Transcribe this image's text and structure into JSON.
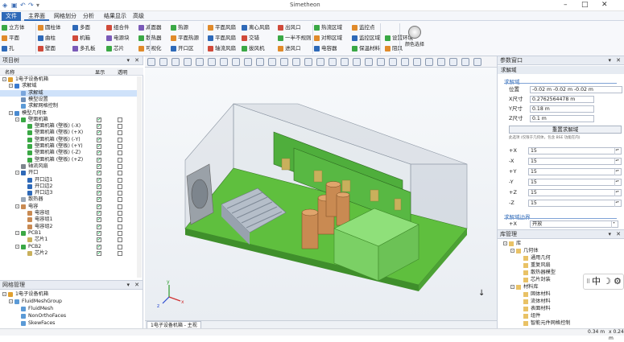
{
  "app": {
    "title": "Simetheon"
  },
  "menu": [
    "文件",
    "主界面",
    "网格划分",
    "分析",
    "结果显示",
    "高级"
  ],
  "ribbon": {
    "row1": [
      "立方体",
      "圆柱体",
      "多面",
      "组合件",
      "减面器",
      "热源",
      "平面风扇",
      "离心风扇",
      "出风口",
      "热流区域",
      "监控点"
    ],
    "row2": [
      "平面",
      "曲柱",
      "机箱",
      "电源块",
      "散热器",
      "平面热源",
      "平面风扇",
      "交错",
      "一半不规则",
      "对称区域",
      "监控区域",
      "设置环境"
    ],
    "row3": [
      "孔",
      "壁面",
      "多孔板",
      "芯片",
      "可视化",
      "开口区",
      "轴流风扇",
      "拔风机",
      "进风口",
      "电容器",
      "保温材料",
      "阻风"
    ],
    "big_button": "颜色选择",
    "colors": {
      "accent": "#2e69b8",
      "green": "#3aa845",
      "orange": "#e08a2a",
      "red": "#d04a3a"
    }
  },
  "left_panel": {
    "title": "项目树",
    "columns": [
      "名称",
      "显示",
      "透明"
    ],
    "tree": [
      {
        "d": 0,
        "label": "1电子设备机箱",
        "icon": "project",
        "exp": "-"
      },
      {
        "d": 1,
        "label": "求解域",
        "icon": "domain",
        "exp": "-"
      },
      {
        "d": 2,
        "label": "求解域",
        "icon": "box",
        "sel": true
      },
      {
        "d": 2,
        "label": "模型设置",
        "icon": "gear"
      },
      {
        "d": 2,
        "label": "求解网格控制",
        "icon": "mesh"
      },
      {
        "d": 1,
        "label": "模型几何体",
        "icon": "geom",
        "exp": "-"
      },
      {
        "d": 2,
        "label": "壁面机箱",
        "icon": "green",
        "exp": "-",
        "cb": [
          true,
          false
        ]
      },
      {
        "d": 3,
        "label": "壁面机箱 (壁板) (-X)",
        "icon": "green",
        "cb": [
          true,
          false
        ]
      },
      {
        "d": 3,
        "label": "壁面机箱 (壁板) (+X)",
        "icon": "green",
        "cb": [
          true,
          false
        ]
      },
      {
        "d": 3,
        "label": "壁面机箱 (壁板) (-Y)",
        "icon": "green",
        "cb": [
          true,
          false
        ]
      },
      {
        "d": 3,
        "label": "壁面机箱 (壁板) (+Y)",
        "icon": "green",
        "cb": [
          true,
          false
        ]
      },
      {
        "d": 3,
        "label": "壁面机箱 (壁板) (-Z)",
        "icon": "green",
        "cb": [
          true,
          false
        ]
      },
      {
        "d": 3,
        "label": "壁面机箱 (壁板) (+Z)",
        "icon": "green",
        "cb": [
          true,
          false
        ]
      },
      {
        "d": 2,
        "label": "轴流风扇",
        "icon": "fan",
        "cb": [
          true,
          false
        ]
      },
      {
        "d": 2,
        "label": "开口",
        "icon": "open",
        "exp": "-",
        "cb": [
          true,
          false
        ]
      },
      {
        "d": 3,
        "label": "开口边1",
        "icon": "open",
        "cb": [
          true,
          false
        ]
      },
      {
        "d": 3,
        "label": "开口边2",
        "icon": "open",
        "cb": [
          true,
          false
        ]
      },
      {
        "d": 3,
        "label": "开口边3",
        "icon": "open",
        "cb": [
          true,
          false
        ]
      },
      {
        "d": 2,
        "label": "散热器",
        "icon": "sink",
        "cb": [
          true,
          false
        ]
      },
      {
        "d": 2,
        "label": "电容",
        "icon": "cap",
        "exp": "-",
        "cb": [
          true,
          false
        ]
      },
      {
        "d": 3,
        "label": "电容组",
        "icon": "cap",
        "cb": [
          true,
          false
        ]
      },
      {
        "d": 3,
        "label": "电容组1",
        "icon": "cap",
        "cb": [
          true,
          false
        ]
      },
      {
        "d": 3,
        "label": "电容组2",
        "icon": "cap",
        "cb": [
          true,
          false
        ]
      },
      {
        "d": 2,
        "label": "PCB1",
        "icon": "pcb",
        "exp": "-",
        "cb": [
          true,
          false
        ]
      },
      {
        "d": 3,
        "label": "芯片1",
        "icon": "chip",
        "cb": [
          true,
          false
        ]
      },
      {
        "d": 2,
        "label": "PCB2",
        "icon": "pcb",
        "exp": "-",
        "cb": [
          true,
          false
        ]
      },
      {
        "d": 3,
        "label": "芯片2",
        "icon": "chip",
        "cb": [
          true,
          false
        ]
      }
    ]
  },
  "mesh_panel": {
    "title": "网格管理",
    "items": [
      {
        "d": 0,
        "label": "1电子设备机箱",
        "exp": "-",
        "icon": "project"
      },
      {
        "d": 1,
        "label": "FluidMeshGroup",
        "exp": "-",
        "icon": "mesh"
      },
      {
        "d": 2,
        "label": "FluidMesh",
        "icon": "mesh"
      },
      {
        "d": 2,
        "label": "NonOrthoFaces",
        "icon": "mesh"
      },
      {
        "d": 2,
        "label": "SkewFaces",
        "icon": "mesh"
      }
    ]
  },
  "viewport": {
    "tab": "1电子设备机箱 - 主视",
    "axis_x": "x",
    "axis_y": "y",
    "axis_z": "z",
    "arrow": "↓"
  },
  "right_panel": {
    "title": "参数窗口",
    "section_title": "求解域",
    "sub1": "求解域",
    "labels": {
      "pos": "位置",
      "x": "X尺寸",
      "y": "Y尺寸",
      "z": "Z尺寸"
    },
    "values": {
      "pos": "-0.02 m -0.02 m -0.02 m",
      "x": "0.2762564478 m",
      "y": "0.18 m",
      "z": "0.1 m"
    },
    "reset_button": "重置求解域",
    "note": "此选项 (仅限于几何体，包含 BSE 功能在内)",
    "pad": [
      {
        "label": "+X",
        "value": "15"
      },
      {
        "label": "-X",
        "value": "15"
      },
      {
        "label": "+Y",
        "value": "15"
      },
      {
        "label": "-Y",
        "value": "15"
      },
      {
        "label": "+Z",
        "value": "15"
      },
      {
        "label": "-Z",
        "value": "15"
      }
    ],
    "sub2": "求解域边界",
    "boundary": {
      "label": "+X",
      "value": "开放"
    }
  },
  "lib_panel": {
    "title": "库管理",
    "items": [
      {
        "d": 0,
        "label": "库",
        "exp": "-"
      },
      {
        "d": 1,
        "label": "几何体",
        "exp": "-"
      },
      {
        "d": 2,
        "label": "通用几何"
      },
      {
        "d": 2,
        "label": "重复风扇"
      },
      {
        "d": 2,
        "label": "散热器模型"
      },
      {
        "d": 2,
        "label": "芯片封装"
      },
      {
        "d": 1,
        "label": "材料库",
        "exp": "-"
      },
      {
        "d": 2,
        "label": "固体材料"
      },
      {
        "d": 2,
        "label": "流体材料"
      },
      {
        "d": 2,
        "label": "表面材料"
      },
      {
        "d": 2,
        "label": "组件"
      },
      {
        "d": 2,
        "label": "智能元件网格控制"
      }
    ]
  },
  "ime": {
    "chinese": "中",
    "moon": "☽",
    "gear": "⚙"
  },
  "status": {
    "left": "0.34 m",
    "right": "x 0.24 m"
  }
}
